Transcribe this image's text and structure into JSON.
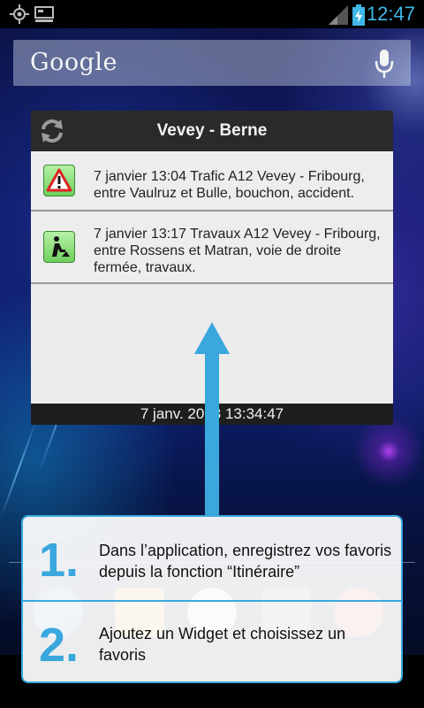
{
  "status_bar": {
    "time": "12:47",
    "left_icons": [
      "gps-icon",
      "debug-icon"
    ],
    "right_icons": [
      "signal-icon",
      "battery-icon"
    ]
  },
  "search_bar": {
    "label": "Google",
    "mic_icon": "mic-icon"
  },
  "widget": {
    "title": "Vevey - Berne",
    "items": [
      {
        "icon": "warning-triangle-icon",
        "text": "7 janvier 13:04 Trafic A12 Vevey - Fribourg, entre Vaulruz et Bulle, bouchon, accident."
      },
      {
        "icon": "roadworks-icon",
        "text": "7 janvier 13:17 Travaux A12 Vevey - Fribourg, entre Rossens et Matran, voie de droite fermée, travaux."
      }
    ],
    "footer": "7 janv. 2013 13:34:47"
  },
  "instructions": [
    {
      "number": "1.",
      "text": "Dans l’application, enregistrez vos favoris depuis la fonction “Itinéraire”"
    },
    {
      "number": "2.",
      "text": "Ajoutez un Widget et choisissez un favoris"
    }
  ],
  "colors": {
    "accent": "#3aa8dd",
    "status_time": "#3fb7e8",
    "widget_bg": "#ececec",
    "widget_header": "#2a2a2a"
  }
}
